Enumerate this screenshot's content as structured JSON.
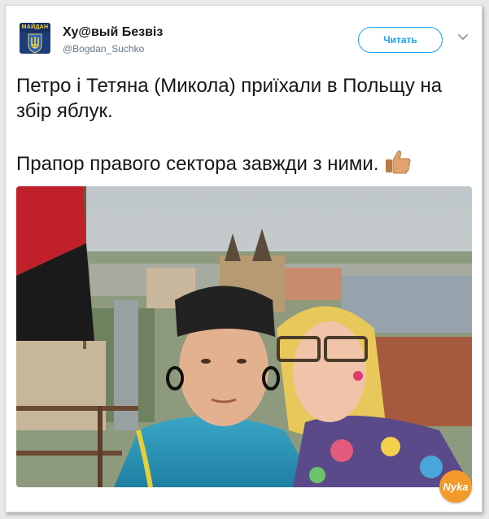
{
  "author": {
    "display_name": "Ху@вый Безвіз",
    "handle": "@Bogdan_Suchko",
    "avatar_label": "МАЙДАН"
  },
  "actions": {
    "follow_label": "Читать"
  },
  "tweet": {
    "line1": "Петро і Тетяна (Микола) приїхали в Польщу на збір яблук.",
    "line2": "Прапор правого сектора завжди з ними.",
    "emoji": "thumbs-up"
  },
  "watermark": {
    "text": "Nyka"
  },
  "colors": {
    "accent": "#1da1f2",
    "name_text": "#14171a",
    "handle_text": "#657786",
    "flag_red": "#c0202a",
    "flag_black": "#1a1a1a"
  },
  "icons": [
    "trident-emblem-icon",
    "chevron-down-icon",
    "thumbs-up-icon"
  ]
}
